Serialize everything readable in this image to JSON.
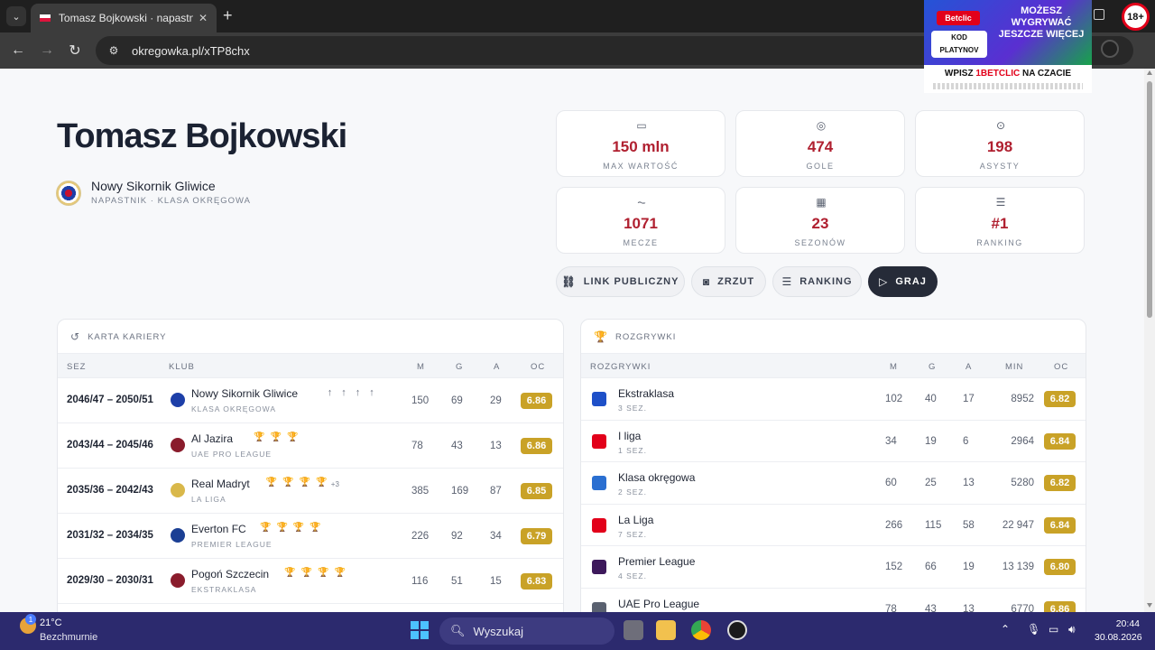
{
  "browser": {
    "tab_title": "Tomasz Bojkowski · napastnik · ",
    "url": "okregowka.pl/xTP8chx"
  },
  "ad": {
    "brand": "Betclic",
    "headline": "MOŻESZ WYGRYWAĆ JESZCZE WIĘCEJ",
    "code_label": "KOD",
    "code_value": "PLATYNOV",
    "cta_prefix": "WPISZ",
    "cta_code": "1BETCLIC",
    "cta_suffix": "NA CZACIE",
    "age_badge": "18+"
  },
  "player": {
    "name": "Tomasz Bojkowski",
    "club": "Nowy Sikornik Gliwice",
    "subtitle": "NAPASTNIK · KLASA OKRĘGOWA"
  },
  "stats": [
    {
      "icon": "money-icon",
      "value": "150 mln",
      "label": "MAX WARTOŚĆ"
    },
    {
      "icon": "goal-icon",
      "value": "474",
      "label": "GOLE"
    },
    {
      "icon": "assist-icon",
      "value": "198",
      "label": "ASYSTY"
    },
    {
      "icon": "activity-icon",
      "value": "1071",
      "label": "MECZE"
    },
    {
      "icon": "calendar-icon",
      "value": "23",
      "label": "SEZONÓW"
    },
    {
      "icon": "ranking-icon",
      "value": "#1",
      "label": "RANKING"
    }
  ],
  "actions": {
    "public_link": "LINK PUBLICZNY",
    "screenshot": "ZRZUT",
    "ranking": "RANKING",
    "play": "GRAJ"
  },
  "career": {
    "title": "KARTA KARIERY",
    "headers": {
      "season": "SEZ",
      "club": "KLUB",
      "m": "M",
      "g": "G",
      "a": "A",
      "oc": "OC"
    },
    "rows": [
      {
        "season": "2046/47 – 2050/51",
        "club": "Nowy Sikornik Gliwice",
        "league": "KLASA OKRĘGOWA",
        "badges": "↑↑↑↑",
        "more": "",
        "m": "150",
        "g": "69",
        "a": "29",
        "oc": "6.86",
        "logo_color": "#1d3fa8"
      },
      {
        "season": "2043/44 – 2045/46",
        "club": "Al Jazira",
        "league": "UAE PRO LEAGUE",
        "badges": "🏆🏆🏆",
        "more": "",
        "m": "78",
        "g": "43",
        "a": "13",
        "oc": "6.86",
        "logo_color": "#8a1c2c"
      },
      {
        "season": "2035/36 – 2042/43",
        "club": "Real Madryt",
        "league": "LA LIGA",
        "badges": "🏆🏆🏆🏆",
        "more": "+3",
        "m": "385",
        "g": "169",
        "a": "87",
        "oc": "6.85",
        "logo_color": "#d9b84a"
      },
      {
        "season": "2031/32 – 2034/35",
        "club": "Everton FC",
        "league": "PREMIER LEAGUE",
        "badges": "🏆🏆🏆🏆",
        "more": "",
        "m": "226",
        "g": "92",
        "a": "34",
        "oc": "6.79",
        "logo_color": "#1b3f94"
      },
      {
        "season": "2029/30 – 2030/31",
        "club": "Pogoń Szczecin",
        "league": "EKSTRAKLASA",
        "badges": "🏆🏆🏆🏆",
        "more": "",
        "m": "116",
        "g": "51",
        "a": "15",
        "oc": "6.83",
        "logo_color": "#8a1c2c"
      }
    ]
  },
  "competitions": {
    "title": "ROZGRYWKI",
    "headers": {
      "name": "ROZGRYWKI",
      "m": "M",
      "g": "G",
      "a": "A",
      "min": "MIN",
      "oc": "OC"
    },
    "rows": [
      {
        "name": "Ekstraklasa",
        "seasons": "3 SEZ.",
        "m": "102",
        "g": "40",
        "a": "17",
        "min": "8952",
        "oc": "6.82",
        "logo_color": "#1e50c8"
      },
      {
        "name": "I liga",
        "seasons": "1 SEZ.",
        "m": "34",
        "g": "19",
        "a": "6",
        "min": "2964",
        "oc": "6.84",
        "logo_color": "#e2001a"
      },
      {
        "name": "Klasa okręgowa",
        "seasons": "2 SEZ.",
        "m": "60",
        "g": "25",
        "a": "13",
        "min": "5280",
        "oc": "6.82",
        "logo_color": "#2a6fd1"
      },
      {
        "name": "La Liga",
        "seasons": "7 SEZ.",
        "m": "266",
        "g": "115",
        "a": "58",
        "min": "22 947",
        "oc": "6.84",
        "logo_color": "#e2001a"
      },
      {
        "name": "Premier League",
        "seasons": "4 SEZ.",
        "m": "152",
        "g": "66",
        "a": "19",
        "min": "13 139",
        "oc": "6.80",
        "logo_color": "#3d195b"
      },
      {
        "name": "UAE Pro League",
        "seasons": "",
        "m": "78",
        "g": "43",
        "a": "13",
        "min": "6770",
        "oc": "6.86",
        "logo_color": "#5a6170"
      }
    ]
  },
  "taskbar": {
    "temp": "21°C",
    "weather_badge": "1",
    "condition": "Bezchmurnie",
    "search_placeholder": "Wyszukaj",
    "time": "20:44",
    "date": "30.08.2026"
  }
}
